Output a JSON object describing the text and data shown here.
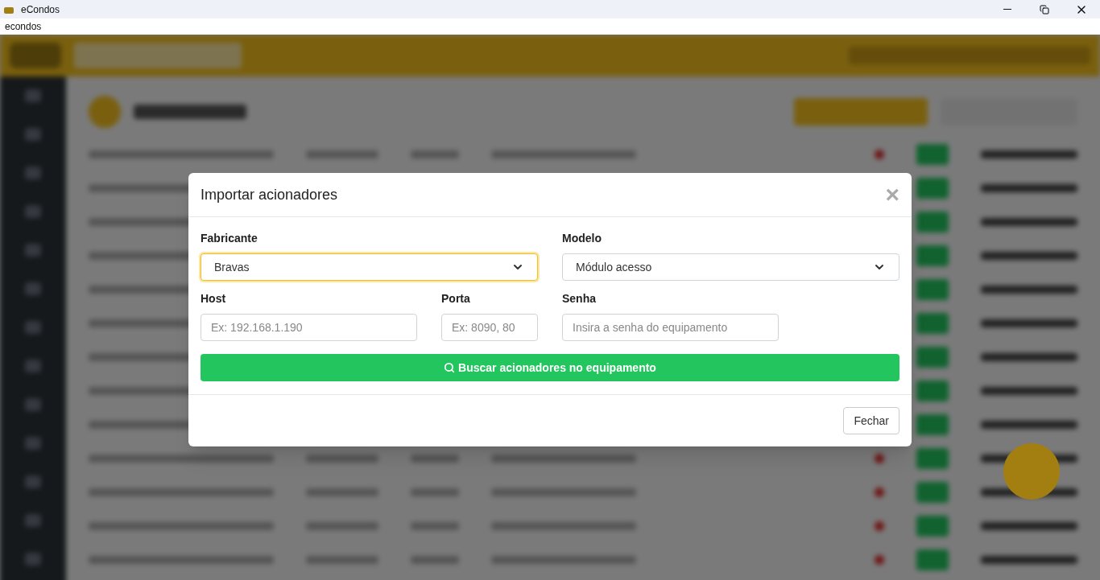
{
  "window": {
    "title": "eCondos"
  },
  "app_label": "econdos",
  "modal": {
    "title": "Importar acionadores",
    "close": "×",
    "fields": [
      {
        "kind": "select",
        "label": "Fabricante",
        "value": "Bravas",
        "focused": true
      },
      {
        "kind": "select",
        "label": "Modelo",
        "value": "Módulo acesso",
        "focused": false
      },
      {
        "kind": "input",
        "label": "Host",
        "placeholder": "Ex: 192.168.1.190"
      },
      {
        "kind": "input",
        "label": "Porta",
        "placeholder": "Ex: 8090, 80"
      },
      {
        "kind": "input",
        "label": "Senha",
        "placeholder": "Insira a senha do equipamento"
      }
    ],
    "search_button": "Buscar acionadores no equipamento",
    "footer_button": "Fechar"
  }
}
